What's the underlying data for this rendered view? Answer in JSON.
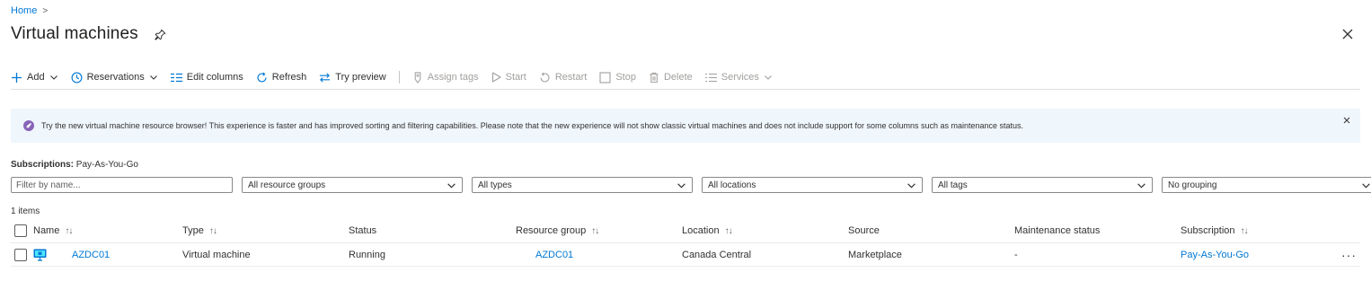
{
  "breadcrumb": {
    "home": "Home",
    "separator": ">"
  },
  "page": {
    "title": "Virtual machines"
  },
  "toolbar": {
    "add": "Add",
    "reservations": "Reservations",
    "edit_columns": "Edit columns",
    "refresh": "Refresh",
    "try_preview": "Try preview",
    "assign_tags": "Assign tags",
    "start": "Start",
    "restart": "Restart",
    "stop": "Stop",
    "delete": "Delete",
    "services": "Services"
  },
  "banner": {
    "text": "Try the new virtual machine resource browser! This experience is faster and has improved sorting and filtering capabilities. Please note that the new experience will not show classic virtual machines and does not include support for some columns such as maintenance status."
  },
  "subscriptions": {
    "label": "Subscriptions:",
    "value": "Pay-As-You-Go"
  },
  "filters": {
    "name_placeholder": "Filter by name...",
    "resource_groups": "All resource groups",
    "types": "All types",
    "locations": "All locations",
    "tags": "All tags",
    "grouping": "No grouping"
  },
  "items_count": "1 items",
  "table": {
    "columns": {
      "name": "Name",
      "type": "Type",
      "status": "Status",
      "resource_group": "Resource group",
      "location": "Location",
      "source": "Source",
      "maintenance_status": "Maintenance status",
      "subscription": "Subscription"
    },
    "sort_icon": "↑↓",
    "rows": [
      {
        "name": "AZDC01",
        "type": "Virtual machine",
        "status": "Running",
        "resource_group": "AZDC01",
        "location": "Canada Central",
        "source": "Marketplace",
        "maintenance_status": "-",
        "subscription": "Pay-As-You-Go"
      }
    ]
  },
  "icons": {
    "pin": "pin-icon",
    "close": "close-icon",
    "banner": "rocket-badge-icon",
    "vm": "virtual-machine-icon",
    "more": "more-actions-icon"
  },
  "colors": {
    "link": "#0078d4",
    "banner_bg": "#eff6fc",
    "banner_icon": "#8764b8",
    "disabled": "#a19f9d"
  }
}
